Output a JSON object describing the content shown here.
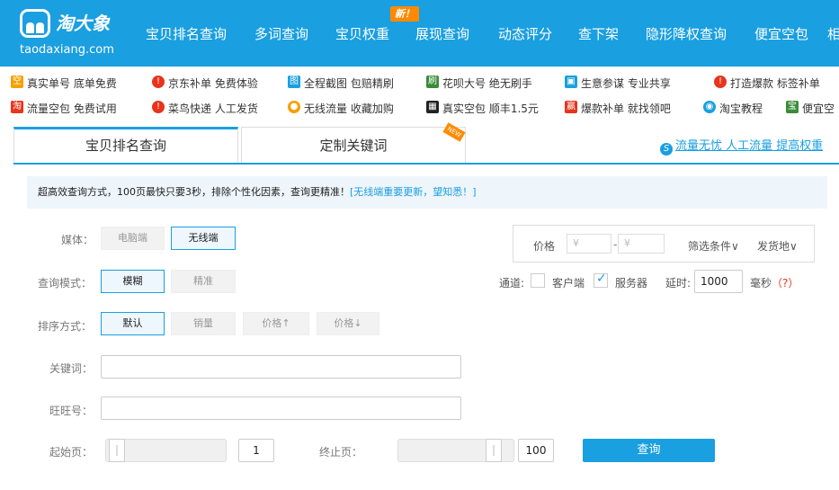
{
  "header": {
    "logo_cn": "淘大象",
    "logo_en": "taodaxiang.com",
    "nav": [
      "宝贝排名查询",
      "多词查询",
      "宝贝权重",
      "展现查询",
      "动态评分",
      "查下架",
      "隐形降权查询",
      "便宜空包",
      "相"
    ],
    "new_badge": "新！"
  },
  "promos": {
    "row1": [
      "真实单号 底单免费",
      "京东补单 免费体验",
      "全程截图 包赔精刷",
      "花呗大号 绝无刷手",
      "生意参谋 专业共享",
      "打造爆款 标签补单"
    ],
    "row2": [
      "流量空包 免费试用",
      "菜鸟快递 人工发货",
      "无线流量 收藏加购",
      "真实空包 顺丰1.5元",
      "爆款补单 就找领吧",
      "淘宝教程",
      "便宜空"
    ],
    "icons": {
      "kong": "空",
      "jing": "淘",
      "ying": "赢",
      "qian": "快",
      "pian": "图",
      "hua": "刷",
      "fang": "宝"
    },
    "colors": {
      "red": "#e8341c",
      "blue": "#1a9fe0",
      "green": "#3a8c3a",
      "orange": "#f5a000",
      "black": "#222222"
    }
  },
  "tabs": {
    "items": [
      "宝贝排名查询",
      "定制关键词"
    ],
    "ribbon": "NEW",
    "right_link": "流量无忧 人工流量 提高权重",
    "right_link_icon": "S"
  },
  "notice": {
    "text": "超高效查询方式，100页最快只要3秒，排除个性化因素，查询更精准！",
    "link": "[无线端重要更新，望知悉！]"
  },
  "form": {
    "media_label": "媒体：",
    "media_options": [
      "电脑端",
      "无线端"
    ],
    "mode_label": "查询模式：",
    "mode_options": [
      "模糊",
      "精准"
    ],
    "sort_label": "排序方式：",
    "sort_options": [
      "默认",
      "销量",
      "价格↑",
      "价格↓"
    ],
    "keyword_label": "关键词：",
    "wangwang_label": "旺旺号：",
    "start_label": "起始页：",
    "end_label": "终止页：",
    "start_page": "1",
    "end_page": "100",
    "query_button": "查询",
    "filter": {
      "price_label": "价格",
      "price_min_placeholder": "¥",
      "dash": "-",
      "price_max_placeholder": "¥",
      "conditions": "筛选条件∨",
      "ship_from": "发货地∨"
    },
    "channel_label": "通道:",
    "client_label": "客户端",
    "server_label": "服务器",
    "delay_label": "延时:",
    "delay_value": "1000",
    "ms_label": "毫秒",
    "help": "（?）"
  }
}
